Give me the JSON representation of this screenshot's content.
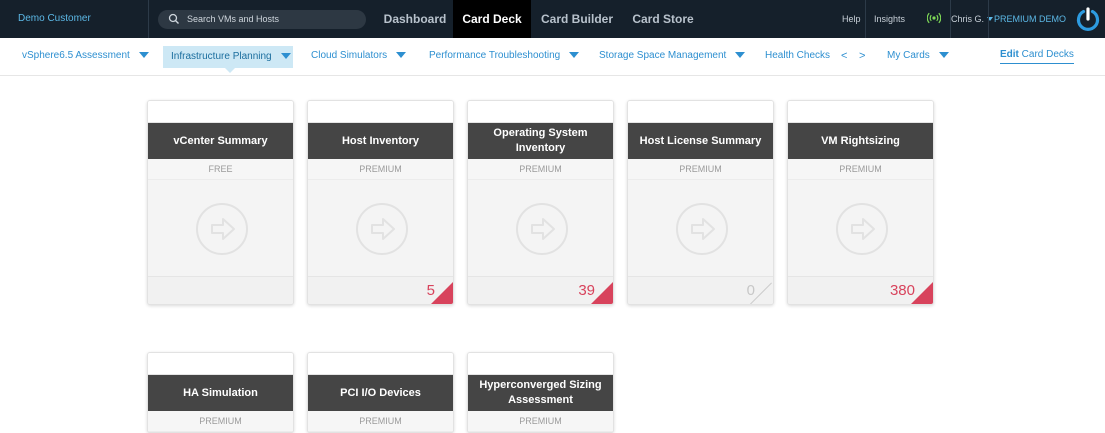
{
  "topbar": {
    "customer": "Demo Customer",
    "search_placeholder": "Search VMs and Hosts",
    "tabs": [
      {
        "label": "Dashboard"
      },
      {
        "label": "Card Deck"
      },
      {
        "label": "Card Builder"
      },
      {
        "label": "Card Store"
      }
    ],
    "help": "Help",
    "insights": "Insights",
    "user": "Chris G.",
    "plan": "PREMIUM DEMO",
    "colors": {
      "bg": "#15202b",
      "active_tab": "#000000",
      "accent": "#5cb8e6"
    }
  },
  "subnav": {
    "items": [
      {
        "label": "vSphere6.5 Assessment"
      },
      {
        "label": "Infrastructure Planning"
      },
      {
        "label": "Cloud Simulators"
      },
      {
        "label": "Performance Troubleshooting"
      },
      {
        "label": "Storage Space Management"
      },
      {
        "label": "Health Checks"
      },
      {
        "label": "My Cards"
      }
    ],
    "prev_arrow": "<",
    "next_arrow": ">",
    "edit_bold": "Edit",
    "edit_rest": " Card Decks"
  },
  "cards": [
    {
      "title": "vCenter Summary",
      "tier": "FREE",
      "count": ""
    },
    {
      "title": "Host Inventory",
      "tier": "PREMIUM",
      "count": "5"
    },
    {
      "title": "Operating System Inventory",
      "tier": "PREMIUM",
      "count": "39"
    },
    {
      "title": "Host License Summary",
      "tier": "PREMIUM",
      "count": "0"
    },
    {
      "title": "VM Rightsizing",
      "tier": "PREMIUM",
      "count": "380"
    },
    {
      "title": "HA Simulation",
      "tier": "PREMIUM",
      "count": ""
    },
    {
      "title": "PCI I/O Devices",
      "tier": "PREMIUM",
      "count": ""
    },
    {
      "title": "Hyperconverged Sizing Assessment",
      "tier": "PREMIUM",
      "count": ""
    }
  ],
  "icons": {
    "search": "search-icon",
    "signal": "signal-icon",
    "logo": "power-logo-icon",
    "card_action": "arrow-right-icon"
  }
}
